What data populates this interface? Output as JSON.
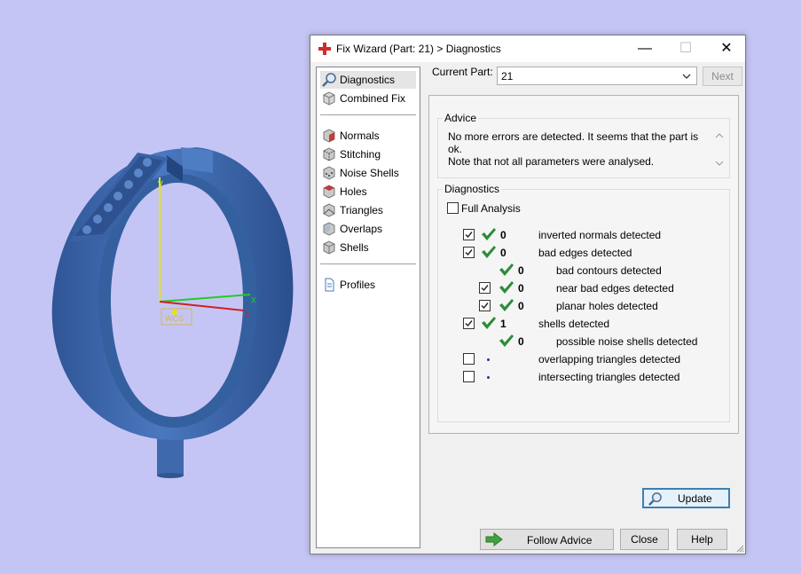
{
  "viewport": {
    "axis_labels": {
      "y": "y",
      "x": "x",
      "z": "z"
    },
    "wcs_label": "WCS"
  },
  "window": {
    "title": "Fix Wizard (Part: 21) > Diagnostics",
    "controls": {
      "minimize": "—",
      "maximize": "☐",
      "close": "✕"
    }
  },
  "nav": {
    "items": [
      {
        "label": "Diagnostics",
        "icon": "magnifier-icon"
      },
      {
        "label": "Combined Fix",
        "icon": "cube-icon"
      },
      {
        "label": "Normals",
        "icon": "normals-cube-icon"
      },
      {
        "label": "Stitching",
        "icon": "stitching-cube-icon"
      },
      {
        "label": "Noise Shells",
        "icon": "noise-shells-cube-icon"
      },
      {
        "label": "Holes",
        "icon": "holes-cube-icon"
      },
      {
        "label": "Triangles",
        "icon": "triangles-cube-icon"
      },
      {
        "label": "Overlaps",
        "icon": "overlaps-cube-icon"
      },
      {
        "label": "Shells",
        "icon": "shells-cube-icon"
      },
      {
        "label": "Profiles",
        "icon": "document-icon"
      }
    ]
  },
  "current_part": {
    "label": "Current Part:",
    "value": "21"
  },
  "next_label": "Next",
  "advice": {
    "title": "Advice",
    "line1": "No more errors are detected. It seems that the part is ok.",
    "line2": "Note that not all parameters were analysed."
  },
  "diagnostics": {
    "title": "Diagnostics",
    "full_analysis": "Full Analysis",
    "rows": [
      {
        "count": "0",
        "label": "inverted normals detected",
        "checked": true,
        "status": "ok"
      },
      {
        "count": "0",
        "label": "bad edges detected",
        "checked": true,
        "status": "ok"
      },
      {
        "count": "0",
        "label": "bad contours detected",
        "checked": null,
        "status": "ok"
      },
      {
        "count": "0",
        "label": "near bad edges detected",
        "checked": true,
        "status": "ok"
      },
      {
        "count": "0",
        "label": "planar holes detected",
        "checked": true,
        "status": "ok"
      },
      {
        "count": "1",
        "label": "shells detected",
        "checked": true,
        "status": "ok"
      },
      {
        "count": "0",
        "label": "possible noise shells detected",
        "checked": null,
        "status": "ok"
      },
      {
        "count": "",
        "label": "overlapping triangles detected",
        "checked": false,
        "status": "not-analysed"
      },
      {
        "count": "",
        "label": "intersecting triangles detected",
        "checked": false,
        "status": "not-analysed"
      }
    ],
    "update_label": "Update"
  },
  "footer": {
    "follow_advice": "Follow Advice",
    "close": "Close",
    "help": "Help"
  },
  "colors": {
    "ring": "#3f6db1",
    "background": "#c5c5f5",
    "check_green": "#2e8b3a"
  }
}
